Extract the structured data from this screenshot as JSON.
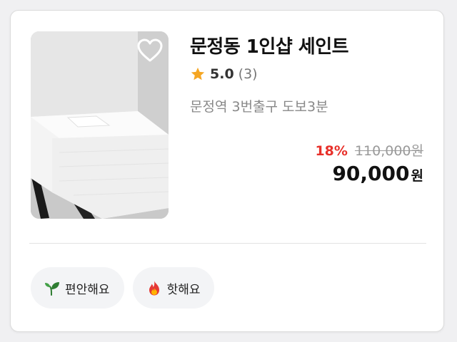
{
  "listing": {
    "title": "문정동 1인샵 세인트",
    "rating": "5.0",
    "review_count": "(3)",
    "location": "문정역 3번출구 도보3분",
    "discount_rate": "18%",
    "original_price": "110,000원",
    "price": "90,000",
    "price_unit": "원",
    "image_icon": "massage-bed-photo",
    "favorite_icon": "heart-outline-icon"
  },
  "tags": [
    {
      "label": "편안해요",
      "icon": "sprout-icon"
    },
    {
      "label": "핫해요",
      "icon": "fire-icon"
    }
  ],
  "colors": {
    "discount": "#e8302a",
    "star": "#f5a623",
    "tag_background": "#f3f4f6",
    "title": "#111111",
    "secondary_text": "#888888"
  }
}
